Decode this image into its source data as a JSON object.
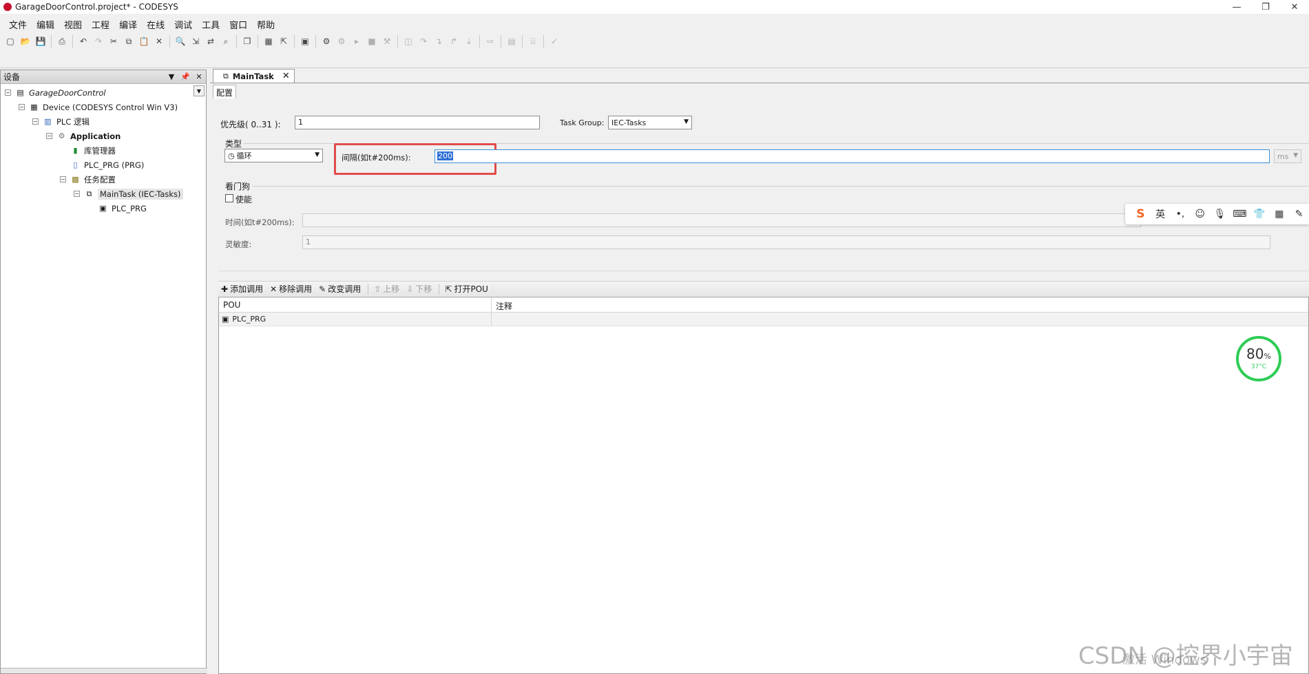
{
  "window": {
    "title": "GarageDoorControl.project* - CODESYS",
    "min_label": "—",
    "restore_label": "❐",
    "close_label": "✕"
  },
  "menu": [
    "文件",
    "编辑",
    "视图",
    "工程",
    "编译",
    "在线",
    "调试",
    "工具",
    "窗口",
    "帮助"
  ],
  "devices_panel": {
    "title": "设备",
    "tree": {
      "project": "GarageDoorControl",
      "device": "Device (CODESYS Control Win V3)",
      "plc_logic": "PLC 逻辑",
      "application": "Application",
      "library_manager": "库管理器",
      "plc_prg": "PLC_PRG (PRG)",
      "task_config": "任务配置",
      "main_task": "MainTask (IEC-Tasks)",
      "main_task_pou": "PLC_PRG"
    }
  },
  "editor": {
    "tab_label": "MainTask",
    "subtab_label": "配置",
    "priority_label": "优先级( 0..31 ):",
    "priority_value": "1",
    "task_group_label": "Task Group:",
    "task_group_value": "IEC-Tasks",
    "type_group_label": "类型",
    "type_value": "循环",
    "interval_label": "间隔(如t#200ms):",
    "interval_value": "200",
    "interval_unit": "ms",
    "watchdog_group_label": "看门狗",
    "watchdog_enable_label": "使能",
    "watchdog_time_label": "时间(如t#200ms):",
    "watchdog_time_value": "",
    "sensitivity_label": "灵敏度:",
    "sensitivity_value": "1"
  },
  "call_toolbar": {
    "add": "添加调用",
    "remove": "移除调用",
    "change": "改变调用",
    "move_up": "上移",
    "move_down": "下移",
    "open_pou": "打开POU"
  },
  "pou_table": {
    "headers": [
      "POU",
      "注释"
    ],
    "rows": [
      {
        "pou": "PLC_PRG",
        "comment": ""
      }
    ]
  },
  "ime": {
    "lang": "英"
  },
  "gauge": {
    "cpu_percent": 80,
    "percent_sign": "%",
    "temperature": "37°C"
  },
  "overlay": {
    "watermark": "CSDN @控界小宇宙",
    "activate": "激活 Windows"
  },
  "colors": {
    "highlight_box": "#e14b4b",
    "gauge": "#2ecc55",
    "selection": "#2e6fd6"
  }
}
